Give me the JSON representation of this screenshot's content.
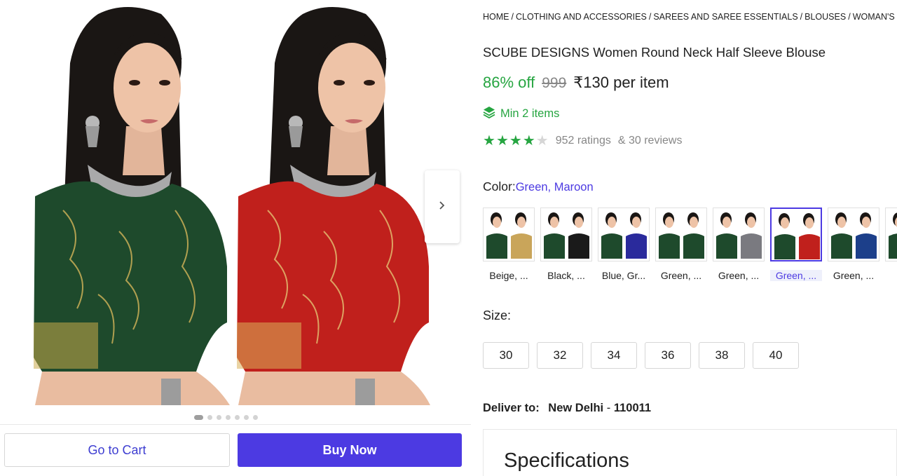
{
  "gallery": {
    "photos": [
      {
        "alt": "green-blouse-model",
        "blouse_color": "#1e4a2c"
      },
      {
        "alt": "maroon-blouse-model",
        "blouse_color": "#c0201c"
      }
    ],
    "next_icon": "chevron-right-icon",
    "dot_count": 7,
    "active_dot": 0
  },
  "actions": {
    "cart_label": "Go to Cart",
    "buy_label": "Buy Now"
  },
  "breadcrumb": [
    "HOME",
    "CLOTHING AND ACCESSORIES",
    "SAREES AND SAREE ESSENTIALS",
    "BLOUSES",
    "WOMAN'S BLOUSES"
  ],
  "product": {
    "title": "SCUBE DESIGNS Women Round Neck Half Sleeve Blouse",
    "discount": "86% off",
    "mrp": "999",
    "price": "₹130 per item",
    "min_items": "Min 2 items",
    "min_icon": "layers-icon",
    "rating": 4,
    "ratings_text": "952 ratings",
    "reviews_text": "& 30 reviews"
  },
  "color": {
    "label": "Color:",
    "selected": "Green, Maroon",
    "options": [
      {
        "label": "Beige, ...",
        "c1": "#1e4a2c",
        "c2": "#c9a55a",
        "selected": false
      },
      {
        "label": "Black, ...",
        "c1": "#1e4a2c",
        "c2": "#1a1a1a",
        "selected": false
      },
      {
        "label": "Blue, Gr...",
        "c1": "#1e4a2c",
        "c2": "#2a2a9c",
        "selected": false
      },
      {
        "label": "Green, ...",
        "c1": "#1e4a2c",
        "c2": "#1e4a2c",
        "selected": false
      },
      {
        "label": "Green, ...",
        "c1": "#1e4a2c",
        "c2": "#7a7a80",
        "selected": false
      },
      {
        "label": "Green, ...",
        "c1": "#1e4a2c",
        "c2": "#c0201c",
        "selected": true
      },
      {
        "label": "Green, ...",
        "c1": "#1e4a2c",
        "c2": "#1c3f8a",
        "selected": false
      },
      {
        "label": "Gr",
        "c1": "#1e4a2c",
        "c2": "#1e4a2c",
        "selected": false
      }
    ]
  },
  "size": {
    "label": "Size:",
    "options": [
      "30",
      "32",
      "34",
      "36",
      "38",
      "40"
    ]
  },
  "delivery": {
    "label": "Deliver to:",
    "city": "New Delhi",
    "separator": "-",
    "pincode": "110011"
  },
  "specifications": {
    "title": "Specifications"
  },
  "colors": {
    "accent": "#4c3ae2",
    "green": "#26a541",
    "muted": "#878787"
  }
}
